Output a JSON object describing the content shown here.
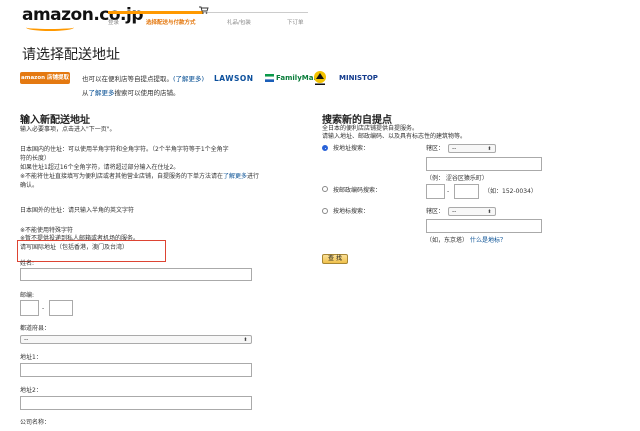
{
  "header": {
    "logo": "amazon.co.jp",
    "steps": [
      {
        "label": "登录",
        "active": false
      },
      {
        "label": "选择配送与付款方式",
        "active": true
      },
      {
        "label": "礼品/包装",
        "active": false
      },
      {
        "label": "下订单",
        "active": false
      }
    ]
  },
  "page_title": "请选择配送地址",
  "pickup_banner": {
    "amazon_badge": "amazon 店铺提取",
    "line1_prefix": "也可以在便利店等自提点提取。",
    "line1_link": "(了解更多)",
    "line2_link": "了解更多",
    "line2_prefix": "从",
    "line2_suffix": "搜索可以使用的店铺。",
    "stores": [
      "LAWSON",
      "FamilyMart",
      "MINISTOP"
    ]
  },
  "new_address": {
    "title": "输入新配送地址",
    "subtitle": "输入必要事项，点击进入\"下一页\"。",
    "jp_note_1": "日本国内的住址：可以使用半角字符和全角字符。（2个半角字符等于1个全角字",
    "jp_note_2": "符的长度）",
    "jp_note_3": "如果住址1超过16个全角字符，请将超过部分输入在住址2。",
    "jp_note_4": "※不能将住址直接填写为便利店或者其他营业店铺，自提服务的下单方法请在",
    "jp_note_link": "了解更多",
    "jp_note_5_suffix": "进行确认。",
    "intl_note": "日本国外的住址：请只输入半角的英文字符",
    "warn_1": "※不能使用特殊字符",
    "warn_2": "※暂不提供投递到私人邮箱或者机场的服务。",
    "intl_link": "请写国际地址（包括香港，澳门及台湾）",
    "name_label": "姓名:",
    "zip_label": "邮编:",
    "zip_dash": "-",
    "prefecture_label": "都道府县：",
    "prefecture_value": "--",
    "address1_label": "地址1：",
    "address2_label": "地址2：",
    "company_label": "公司名称："
  },
  "pickup_search": {
    "title": "搜索新的自提点",
    "desc_1": "全日本的便利店店铺提供自提服务。",
    "desc_2": "请输入地址、邮政编码、以及具有标志性的建筑物等。",
    "opt_address": "按地址搜索：",
    "ward_label": "辖区：",
    "ward_value": "--",
    "example_address": "（例： 涩谷区猿乐町）",
    "opt_zip": "按邮政编码搜索：",
    "zip_dash": "-",
    "example_zip": "（如：152-0034）",
    "opt_landmark": "按地标搜索：",
    "landmark_ward_label": "辖区：",
    "landmark_ward_value": "--",
    "example_landmark": "（如，东京塔）",
    "landmark_link": "什么是地标？",
    "search_button": "查 找"
  }
}
